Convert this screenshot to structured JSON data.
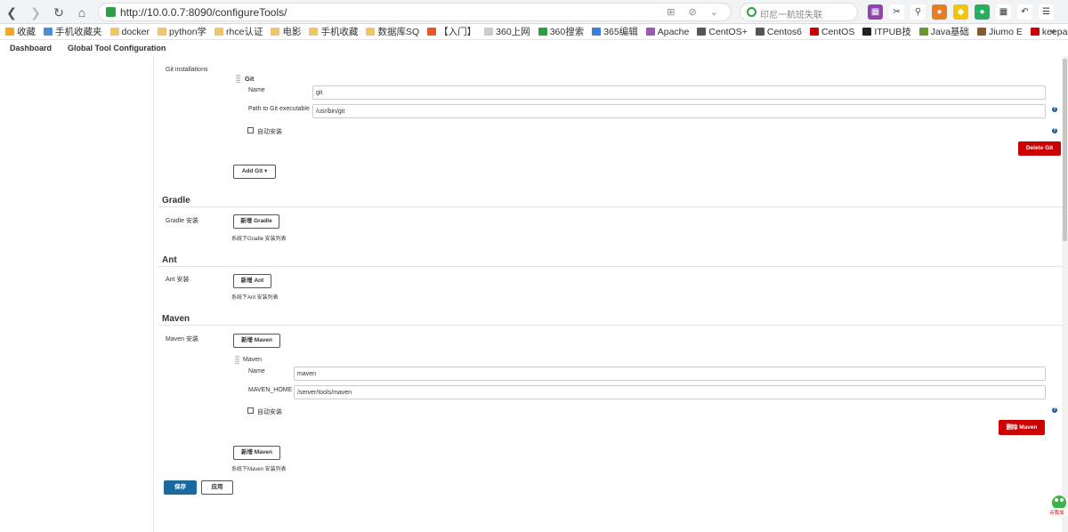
{
  "browser": {
    "url": "http://10.0.0.7:8090/configureTools/",
    "search_placeholder": "印尼一航班失联",
    "addr_icons": "⊞ ⊘ ⌄",
    "bookmarks": [
      {
        "label": "收藏",
        "color": "#f5a623"
      },
      {
        "label": "手机收藏夹",
        "color": "#4a90d9"
      },
      {
        "label": "docker",
        "color": "#f0c36d"
      },
      {
        "label": "python学",
        "color": "#f0c36d"
      },
      {
        "label": "rhce认证",
        "color": "#f0c36d"
      },
      {
        "label": "电影",
        "color": "#f0c36d"
      },
      {
        "label": "手机收藏",
        "color": "#f0c36d"
      },
      {
        "label": "数据库SQ",
        "color": "#f0c36d"
      },
      {
        "label": "【入门】",
        "color": "#e8562a"
      },
      {
        "label": "360上网",
        "color": "#cccccc"
      },
      {
        "label": "360搜索",
        "color": "#2e9d43"
      },
      {
        "label": "365编辑",
        "color": "#3b7dd8"
      },
      {
        "label": "Apache",
        "color": "#9b59b6"
      },
      {
        "label": "CentOS+",
        "color": "#555555"
      },
      {
        "label": "Centos6",
        "color": "#555555"
      },
      {
        "label": "CentOS",
        "color": "#cc0000"
      },
      {
        "label": "ITPUB技",
        "color": "#222222"
      },
      {
        "label": "Java基础",
        "color": "#6a9a2e"
      },
      {
        "label": "Jiumo E",
        "color": "#8b5a2b"
      },
      {
        "label": "keepaliv",
        "color": "#cc0000"
      }
    ],
    "bookmarks_more": "»"
  },
  "breadcrumb": {
    "home": "Dashboard",
    "current": "Global Tool Configuration"
  },
  "git": {
    "section_label": "Git installations",
    "header": "Git",
    "name_label": "Name",
    "name_value": "git",
    "path_label": "Path to Git executable",
    "path_value": "/usr/bin/git",
    "auto_install_label": "自动安装",
    "auto_install_checked": false,
    "delete_label": "Delete Git",
    "add_label": "Add Git ▾"
  },
  "gradle": {
    "title": "Gradle",
    "install_label": "Gradle 安装",
    "add_label": "新增 Gradle",
    "hint": "系统下Gradle 安装列表"
  },
  "ant": {
    "title": "Ant",
    "install_label": "Ant 安装",
    "add_label": "新增 Ant",
    "hint": "系统下Ant 安装列表"
  },
  "maven": {
    "title": "Maven",
    "install_label": "Maven 安装",
    "add_label_top": "新增 Maven",
    "header": "Maven",
    "name_label": "Name",
    "name_value": "maven",
    "home_label": "MAVEN_HOME",
    "home_value": "/server/tools/maven",
    "auto_install_label": "自动安装",
    "auto_install_checked": false,
    "delete_label": "删除 Maven",
    "add_label_bottom": "新增 Maven",
    "hint": "系统下Maven 安装列表"
  },
  "actions": {
    "save": "保存",
    "apply": "应用"
  },
  "corner_badge": "点我加",
  "colors": {
    "primary": "#1a6a9f",
    "danger": "#cc0000",
    "help": "#1f5c9e"
  }
}
